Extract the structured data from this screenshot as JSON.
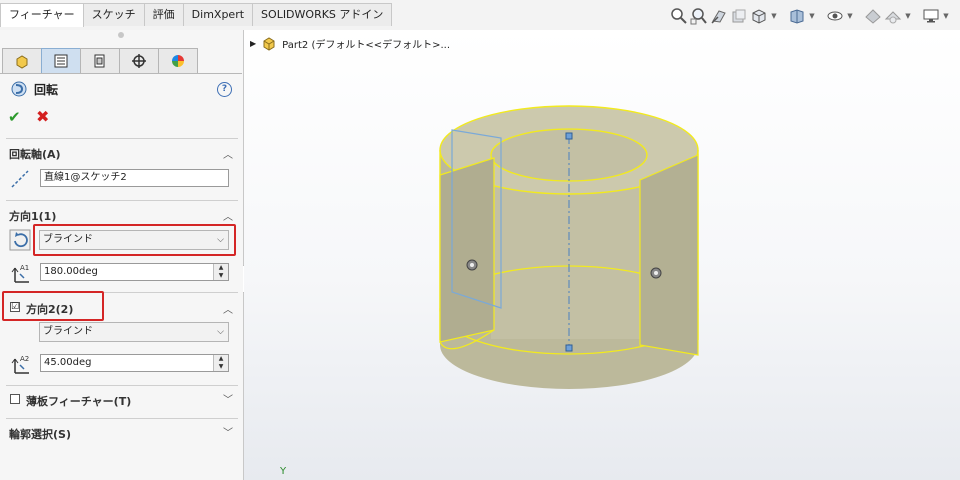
{
  "command_tabs": [
    "フィーチャー",
    "スケッチ",
    "評価",
    "DimXpert",
    "SOLIDWORKS アドイン"
  ],
  "hud_icons": [
    "zoom-fit-icon",
    "zoom-area-icon",
    "previous-view-icon",
    "section-view-icon",
    "view-orientation-icon",
    "display-style-icon",
    "hide-show-icon",
    "edit-appearance-icon",
    "apply-scene-icon",
    "view-settings-icon"
  ],
  "property_tabs": [
    "featuremanager-icon",
    "propertymanager-icon",
    "configurationmanager-icon",
    "dimxpert-icon",
    "displaymanager-icon"
  ],
  "feature": {
    "title": "回転"
  },
  "axis_section": {
    "title": "回転軸(A)",
    "value": "直線1@スケッチ2"
  },
  "direction1": {
    "title": "方向1(1)",
    "end_condition": "ブラインド",
    "angle": "180.00deg"
  },
  "direction2": {
    "title": "方向2(2)",
    "checked": true,
    "check_mark": "☑",
    "end_condition": "ブラインド",
    "angle": "45.00deg"
  },
  "thin_feature": {
    "title": "薄板フィーチャー(T)",
    "checked": false
  },
  "contours": {
    "title": "輪郭選択(S)"
  },
  "tree": {
    "part": "Part2 (デフォルト<<デフォルト>..."
  },
  "viewport": {
    "axis_label": "Y"
  },
  "colors": {
    "highlight_red": "#d42626",
    "model_edge": "#f2ea1e",
    "model_face": "#bcb99b",
    "axis_line": "#4a7fc1"
  }
}
